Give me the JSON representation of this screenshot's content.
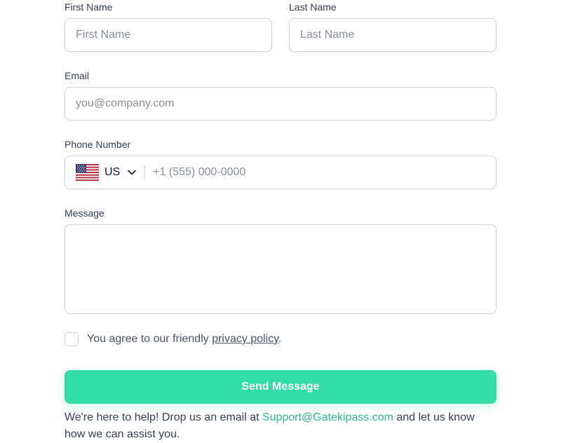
{
  "form": {
    "first_name": {
      "label": "First Name",
      "placeholder": "First Name",
      "value": ""
    },
    "last_name": {
      "label": "Last Name",
      "placeholder": "Last Name",
      "value": ""
    },
    "email": {
      "label": "Email",
      "placeholder": "you@company.com",
      "value": ""
    },
    "phone": {
      "label": "Phone Number",
      "country_code": "US",
      "placeholder": "+1 (555) 000-0000",
      "value": "",
      "flag_icon": "us-flag-icon",
      "dropdown_icon": "chevron-down-icon"
    },
    "message": {
      "label": "Message",
      "placeholder": "",
      "value": ""
    },
    "agreement": {
      "text_before": "You agree to our friendly ",
      "link_text": "privacy policy",
      "text_after": ".",
      "checked": false
    },
    "submit_label": "Send Message"
  },
  "help": {
    "text_before": "We're here to help! Drop us an email at ",
    "email_link": "Support@Gatekipass.com",
    "text_after": " and let us know how we can assist you."
  },
  "colors": {
    "accent": "#34dba7",
    "link": "#2fb592",
    "border": "#d0d5dd"
  }
}
